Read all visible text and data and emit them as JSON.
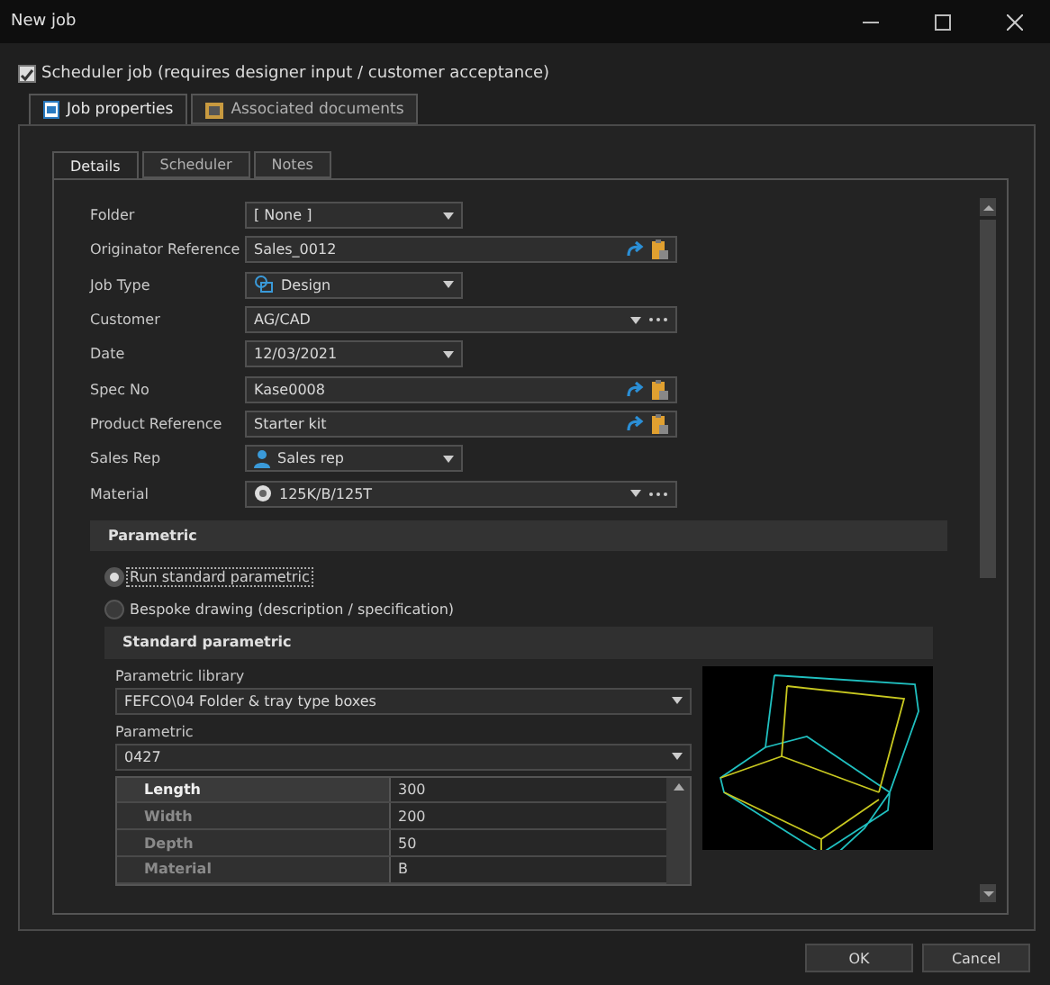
{
  "window": {
    "title": "New job"
  },
  "scheduler_job": {
    "label": "Scheduler job (requires designer input / customer acceptance)",
    "checked": true
  },
  "tabs": [
    {
      "label": "Job properties",
      "selected": true
    },
    {
      "label": "Associated documents",
      "selected": false
    }
  ],
  "sub_tabs": [
    {
      "label": "Details",
      "selected": true
    },
    {
      "label": "Scheduler",
      "selected": false
    },
    {
      "label": "Notes",
      "selected": false
    }
  ],
  "fields": [
    {
      "label": "Folder",
      "value": "[ None ]",
      "kind": "dropdown"
    },
    {
      "label": "Originator Reference",
      "value": "Sales_0012",
      "kind": "text-actions"
    },
    {
      "label": "Job Type",
      "value": "Design",
      "kind": "dropdown"
    },
    {
      "label": "Customer",
      "value": "AG/CAD",
      "kind": "combo-more"
    },
    {
      "label": "Date",
      "value": "12/03/2021",
      "kind": "dropdown"
    },
    {
      "label": "Spec No",
      "value": "Kase0008",
      "kind": "text-actions"
    },
    {
      "label": "Product Reference",
      "value": "Starter kit",
      "kind": "text-actions"
    },
    {
      "label": "Sales Rep",
      "value": "Sales rep",
      "kind": "dropdown"
    },
    {
      "label": "Material",
      "value": "125K/B/125T",
      "kind": "combo-more"
    }
  ],
  "parametric": {
    "title": "Parametric",
    "options": [
      {
        "label": "Run standard parametric",
        "selected": true
      },
      {
        "label": "Bespoke drawing (description / specification)",
        "selected": false
      }
    ],
    "standard": {
      "title": "Standard parametric",
      "library_label": "Parametric library",
      "library": "FEFCO\\04 Folder & tray type boxes",
      "parametric_label": "Parametric",
      "parametric": "0427",
      "rows": [
        {
          "name": "Length",
          "value": "300",
          "selected": true
        },
        {
          "name": "Width",
          "value": "200",
          "selected": false
        },
        {
          "name": "Depth",
          "value": "50",
          "selected": false
        },
        {
          "name": "Material",
          "value": "B",
          "selected": false
        }
      ]
    }
  },
  "buttons": [
    "OK",
    "Cancel"
  ]
}
